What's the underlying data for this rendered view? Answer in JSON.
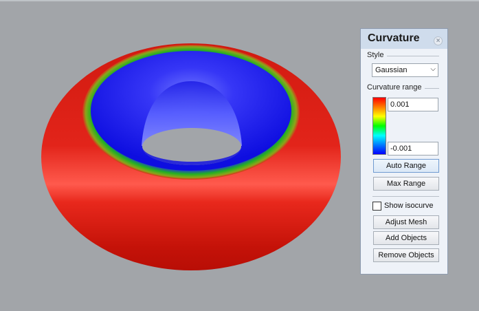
{
  "panel": {
    "title": "Curvature",
    "style_section_label": "Style",
    "style_selected": "Gaussian",
    "range_section_label": "Curvature range",
    "range_max": "0.001",
    "range_min": "-0.001",
    "auto_range_label": "Auto Range",
    "max_range_label": "Max Range",
    "show_isocurve_label": "Show isocurve",
    "show_isocurve_checked": false,
    "adjust_mesh_label": "Adjust Mesh",
    "add_objects_label": "Add Objects",
    "remove_objects_label": "Remove Objects"
  },
  "viewport": {
    "object": "torus",
    "colors": {
      "outer": "#e41a10",
      "transition": "#12a81a",
      "inner": "#1a14e0",
      "background": "#a2a5a9"
    },
    "icons": {
      "close": "close-icon",
      "dropdown": "chevron-down-icon"
    }
  }
}
